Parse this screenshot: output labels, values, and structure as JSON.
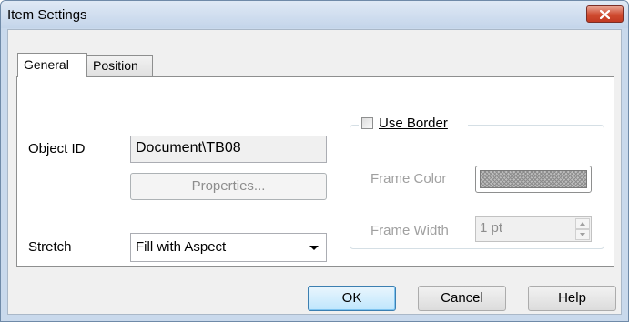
{
  "window": {
    "title": "Item Settings",
    "close_glyph": "×"
  },
  "tabs": [
    {
      "label": "General",
      "active": true
    },
    {
      "label": "Position",
      "active": false
    }
  ],
  "general": {
    "object_id_label": "Object ID",
    "object_id_value": "Document\\TB08",
    "properties_button": "Properties...",
    "stretch_label": "Stretch",
    "stretch_value": "Fill with Aspect"
  },
  "border": {
    "use_border_label": "Use Border",
    "use_border_checked": false,
    "frame_color_label": "Frame Color",
    "frame_width_label": "Frame Width",
    "frame_width_value": "1 pt"
  },
  "buttons": {
    "ok": "OK",
    "cancel": "Cancel",
    "help": "Help"
  },
  "colors": {
    "title_bar": "#c9d9ec",
    "close_button": "#c7432a",
    "dialog_bg": "#f0f0f0",
    "disabled_text": "#a0a0a0"
  }
}
